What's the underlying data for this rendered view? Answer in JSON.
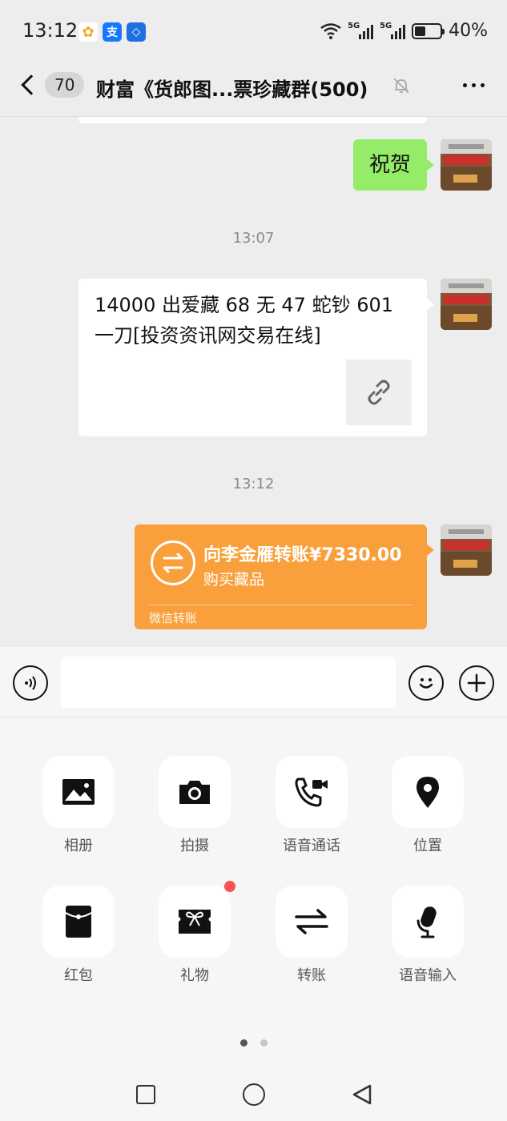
{
  "status_bar": {
    "time": "13:12",
    "apps": [
      {
        "name": "photos-app-icon",
        "glyph": "✿",
        "color": "#f5c33b"
      },
      {
        "name": "alipay-app-icon",
        "glyph": "支",
        "color": "#1677ff"
      },
      {
        "name": "blue-app-icon",
        "glyph": "◇",
        "color": "#1e6fe0"
      }
    ],
    "battery": "40%",
    "network_label": "5G"
  },
  "header": {
    "unread_count": "70",
    "title": "财富《货郎图...票珍藏群(500)"
  },
  "messages": {
    "congrats_text": "祝贺",
    "time_1": "13:07",
    "link_text": "14000 出爱藏 68 无 47 蛇钞 601 一刀[投资资讯网交易在线]",
    "time_2": "13:12",
    "transfer": {
      "amount_text": "向李金雁转账¥7330.00",
      "note": "购买藏品",
      "footer": "微信转账",
      "color": "#f9a03c"
    }
  },
  "input_bar": {
    "placeholder": ""
  },
  "panel": {
    "tools": [
      {
        "label": "相册",
        "icon": "photo-album-icon"
      },
      {
        "label": "拍摄",
        "icon": "camera-icon"
      },
      {
        "label": "语音通话",
        "icon": "video-call-icon"
      },
      {
        "label": "位置",
        "icon": "location-pin-icon"
      },
      {
        "label": "红包",
        "icon": "red-packet-icon"
      },
      {
        "label": "礼物",
        "icon": "gift-icon"
      },
      {
        "label": "转账",
        "icon": "transfer-icon"
      },
      {
        "label": "语音输入",
        "icon": "microphone-icon"
      }
    ],
    "page_count": 2,
    "active_page": 1
  },
  "colors": {
    "self_bubble": "#95ec69",
    "notification_dot": "#fa5151"
  }
}
